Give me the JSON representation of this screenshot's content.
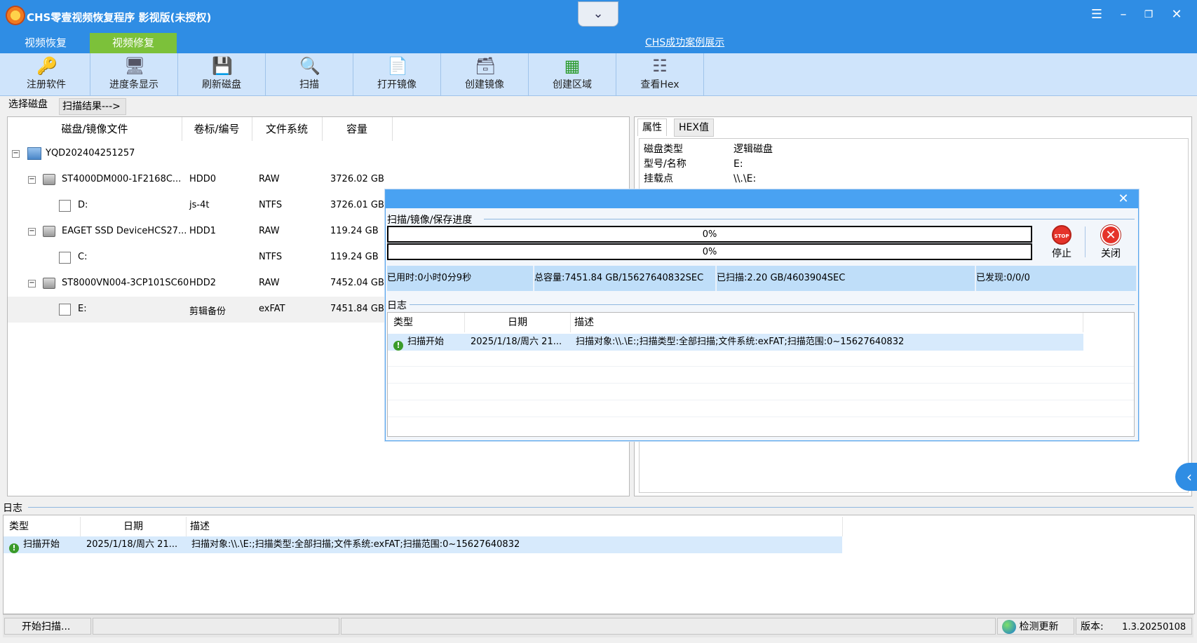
{
  "window": {
    "title": "CHS零壹视频恢复程序 影视版(未授权)",
    "dropdown_icon": "chevron-down-icon",
    "controls": [
      "menu-icon",
      "minimize-icon",
      "restore-icon",
      "close-icon"
    ]
  },
  "nav": {
    "tabs": [
      {
        "label": "视频恢复",
        "active": true
      },
      {
        "label": "视频修复",
        "active": false
      }
    ],
    "link": "CHS成功案例展示"
  },
  "toolbar": {
    "buttons": [
      {
        "label": "注册软件",
        "icon": "key-icon"
      },
      {
        "label": "进度条显示",
        "icon": "monitor-icon"
      },
      {
        "label": "刷新磁盘",
        "icon": "disk-refresh-icon"
      },
      {
        "label": "扫描",
        "icon": "magnifier-icon"
      },
      {
        "label": "打开镜像",
        "icon": "open-image-icon"
      },
      {
        "label": "创建镜像",
        "icon": "create-image-icon"
      },
      {
        "label": "创建区域",
        "icon": "create-region-icon"
      },
      {
        "label": "查看Hex",
        "icon": "hex-view-icon"
      }
    ]
  },
  "crumbs": {
    "select_disk": "选择磁盘",
    "scan_results": "扫描结果--->"
  },
  "disk_table": {
    "columns": [
      "磁盘/镜像文件",
      "卷标/编号",
      "文件系统",
      "容量"
    ],
    "rows": [
      {
        "name": "YQD202404251257",
        "label": "",
        "fs": "",
        "size": "",
        "level": 0,
        "type": "computer"
      },
      {
        "name": "ST4000DM000-1F2168C...",
        "label": "HDD0",
        "fs": "RAW",
        "size": "3726.02 GB",
        "level": 1,
        "type": "disk"
      },
      {
        "name": "D:",
        "label": "js-4t",
        "fs": "NTFS",
        "size": "3726.01 GB",
        "level": 2,
        "type": "partition"
      },
      {
        "name": "EAGET SSD DeviceHCS27...",
        "label": "HDD1",
        "fs": "RAW",
        "size": "119.24 GB",
        "level": 1,
        "type": "disk"
      },
      {
        "name": "C:",
        "label": "",
        "fs": "NTFS",
        "size": "119.24 GB",
        "level": 2,
        "type": "partition"
      },
      {
        "name": "ST8000VN004-3CP101SC60",
        "label": "HDD2",
        "fs": "RAW",
        "size": "7452.04 GB",
        "level": 1,
        "type": "disk"
      },
      {
        "name": "E:",
        "label": "剪辑备份",
        "fs": "exFAT",
        "size": "7451.84 GB",
        "level": 2,
        "type": "partition",
        "selected": true
      }
    ]
  },
  "properties": {
    "tabs": [
      "属性",
      "HEX值"
    ],
    "items": [
      {
        "key": "磁盘类型",
        "value": "逻辑磁盘"
      },
      {
        "key": "型号/名称",
        "value": "E:"
      },
      {
        "key": "挂载点",
        "value": "\\\\.\\E:"
      }
    ]
  },
  "dialog": {
    "section_title": "扫描/镜像/保存进度",
    "progress1": {
      "text": "0%",
      "value": 0
    },
    "progress2": {
      "text": "0%",
      "value": 0
    },
    "stop_label": "停止",
    "close_label": "关闭",
    "stats": {
      "elapsed": "已用时:0小时0分9秒",
      "total": "总容量:7451.84 GB/15627640832SEC",
      "scanned": "已扫描:2.20 GB/4603904SEC",
      "found": "已发现:0/0/0"
    },
    "log_title": "日志",
    "log_columns": [
      "类型",
      "日期",
      "描述"
    ],
    "log_rows": [
      {
        "type": "扫描开始",
        "date": "2025/1/18/周六 21...",
        "desc": "扫描对象:\\\\.\\E:;扫描类型:全部扫描;文件系统:exFAT;扫描范围:0~15627640832"
      }
    ]
  },
  "main_log": {
    "title": "日志",
    "columns": [
      "类型",
      "日期",
      "描述"
    ],
    "rows": [
      {
        "type": "扫描开始",
        "date": "2025/1/18/周六 21...",
        "desc": "扫描对象:\\\\.\\E:;扫描类型:全部扫描;文件系统:exFAT;扫描范围:0~15627640832"
      }
    ]
  },
  "status": {
    "message": "开始扫描...",
    "check_update": "检测更新",
    "version_label": "版本:",
    "version": "1.3.20250108"
  },
  "colors": {
    "titlebar": "#2f8de4",
    "active_tab": "#7cc13a",
    "toolbar": "#cfe4fb",
    "dialog_header": "#49a2f2"
  }
}
